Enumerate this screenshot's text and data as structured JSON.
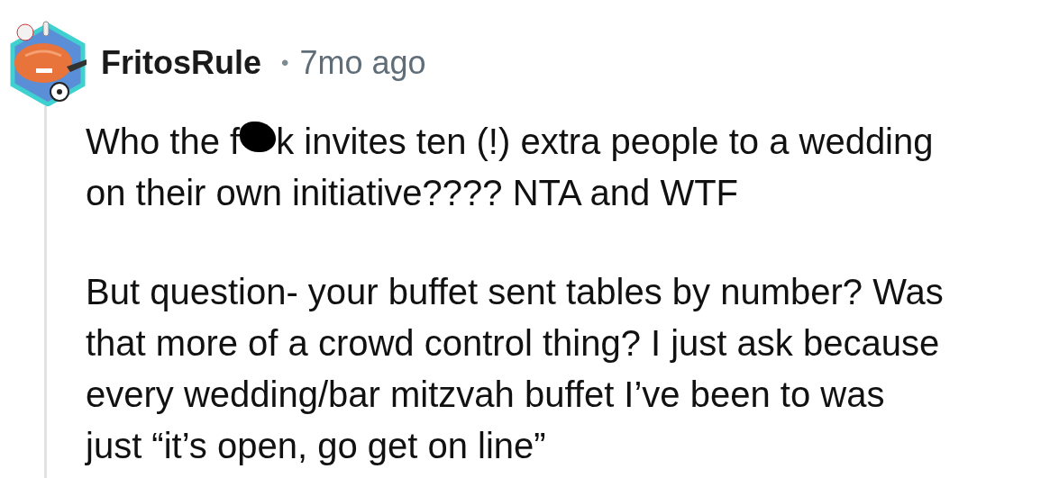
{
  "comment": {
    "author": "FritosRule",
    "separator": "•",
    "time": "7mo ago",
    "body": [
      {
        "lines": [
          {
            "segments": [
              {
                "kind": "text",
                "text": "Who the f"
              },
              {
                "kind": "censor"
              },
              {
                "kind": "text",
                "text": "k invites ten (!) extra people to a wedding"
              }
            ]
          },
          {
            "segments": [
              {
                "kind": "text",
                "text": "on their own initiative???? NTA and WTF"
              }
            ]
          }
        ]
      },
      {
        "lines": [
          {
            "segments": [
              {
                "kind": "text",
                "text": "But question- your buffet sent tables by number? Was"
              }
            ]
          },
          {
            "segments": [
              {
                "kind": "text",
                "text": "that more of a crowd control thing? I just ask because"
              }
            ]
          },
          {
            "segments": [
              {
                "kind": "text",
                "text": "every wedding/bar mitzvah buffet I’ve been to was"
              }
            ]
          },
          {
            "segments": [
              {
                "kind": "text",
                "text": "just “it’s open, go get on line”"
              }
            ]
          }
        ]
      }
    ]
  }
}
